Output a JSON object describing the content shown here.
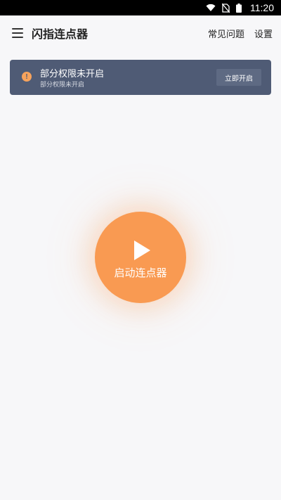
{
  "status_bar": {
    "time": "11:20",
    "icons": [
      "wifi-icon",
      "no-sim-icon",
      "battery-icon"
    ]
  },
  "app_bar": {
    "title": "闪指连点器",
    "actions": {
      "faq": "常见问题",
      "settings": "设置"
    }
  },
  "notice": {
    "title": "部分权限未开启",
    "subtitle": "部分权限未开启",
    "button_label": "立即开启",
    "icon_glyph": "!"
  },
  "start_button": {
    "label": "启动连点器"
  },
  "colors": {
    "accent": "#f99a52",
    "notice_bg": "#4f5b75",
    "page_bg": "#f7f7f9"
  }
}
